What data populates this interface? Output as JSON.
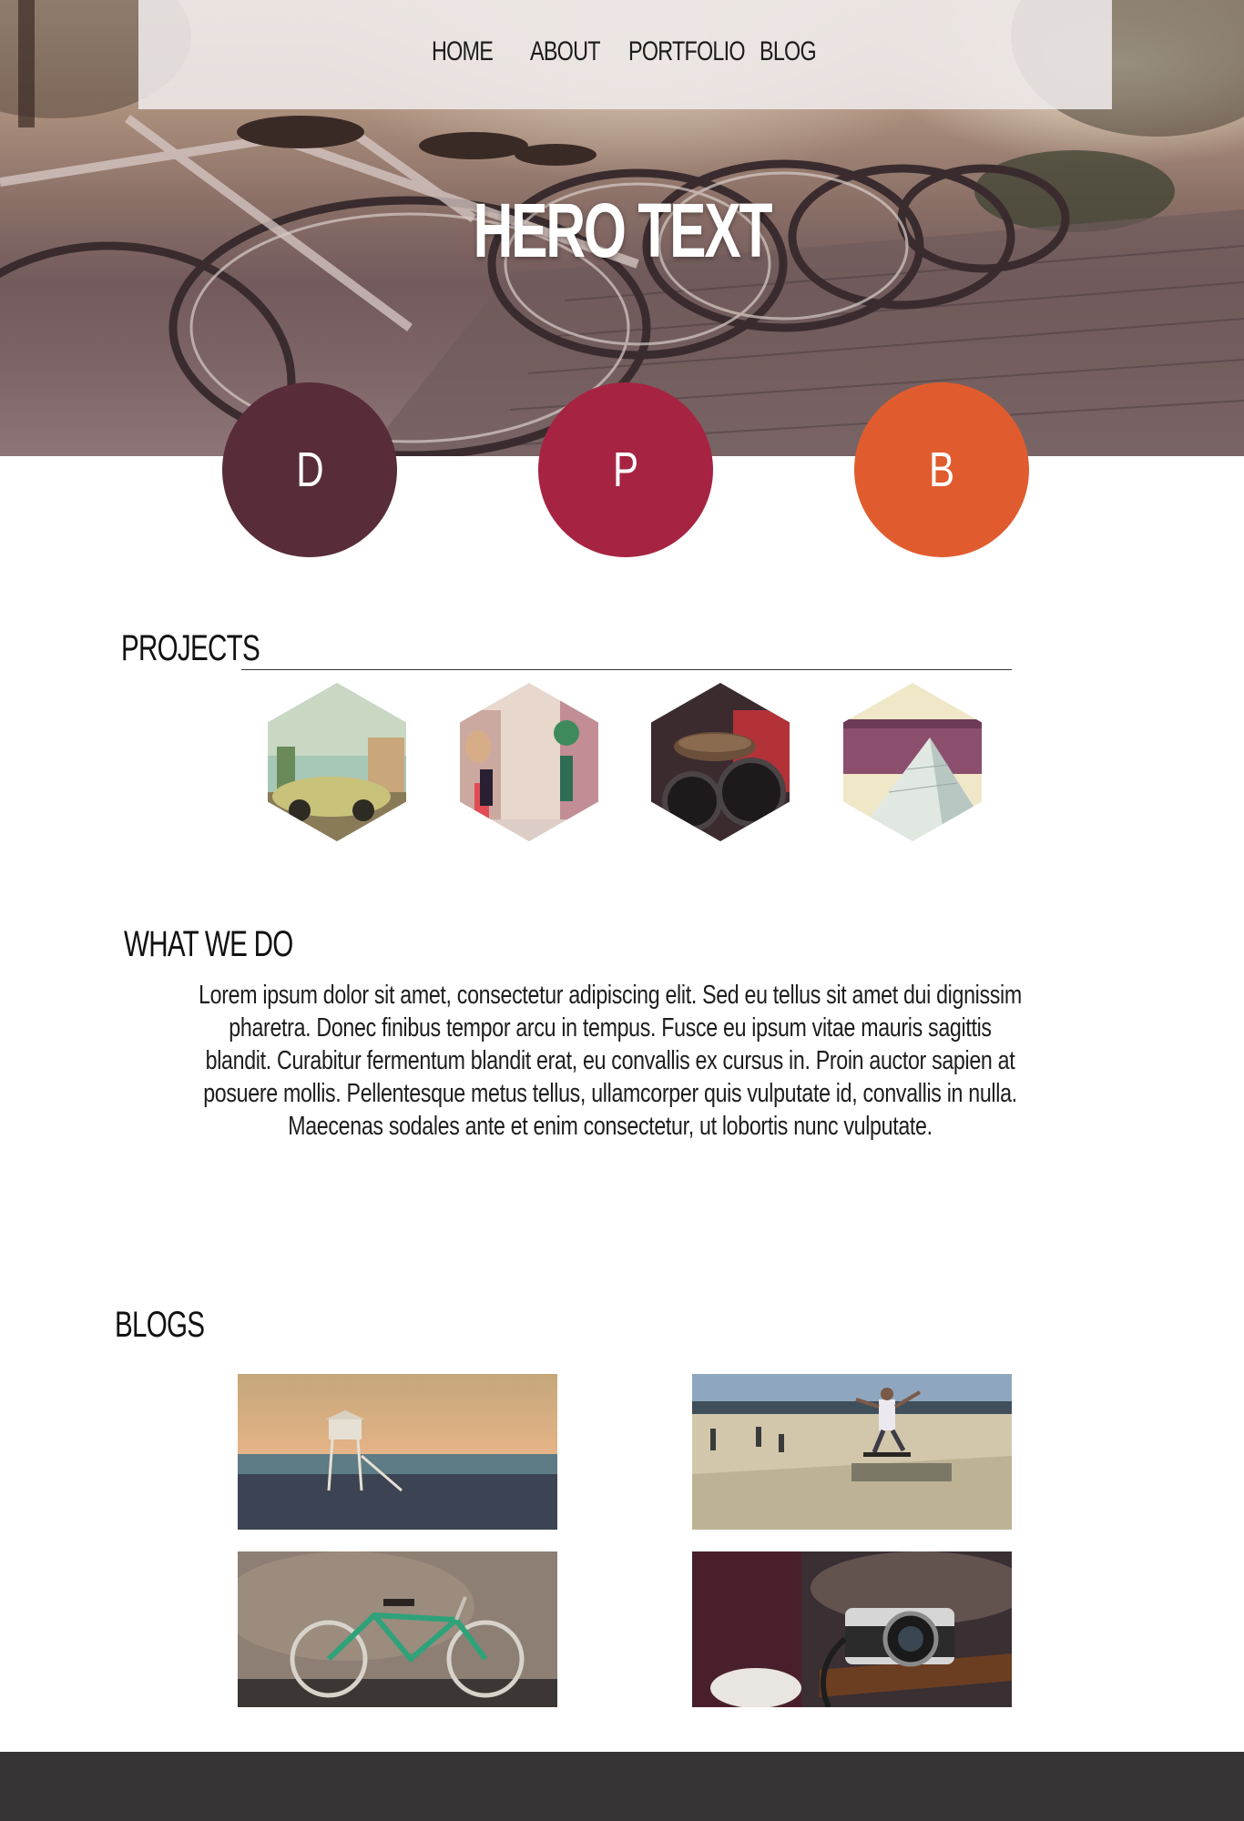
{
  "nav": {
    "items": [
      {
        "label": "HOME"
      },
      {
        "label": "ABOUT"
      },
      {
        "label": "PORTFOLIO"
      },
      {
        "label": "BLOG"
      }
    ]
  },
  "hero": {
    "title": "HERO TEXT",
    "image": "bicycles-in-a-row-photo"
  },
  "circles": [
    {
      "letter": "D",
      "color": "#582c39"
    },
    {
      "letter": "P",
      "color": "#a62442"
    },
    {
      "letter": "B",
      "color": "#e05c2e"
    }
  ],
  "projects": {
    "heading": "PROJECTS",
    "thumbnails": [
      "vintage-car-photo",
      "city-street-photo",
      "bicycle-saddle-photo",
      "louvre-pyramid-photo"
    ]
  },
  "what_we_do": {
    "heading": "WHAT WE DO",
    "body": "Lorem ipsum dolor sit amet, consectetur adipiscing elit. Sed eu tellus sit amet dui dignissim pharetra. Donec finibus tempor arcu in tempus. Fusce eu ipsum vitae mauris sagittis blandit. Curabitur fermentum blandit erat, eu convallis ex cursus in. Proin auctor sapien at posuere mollis. Pellentesque metus tellus, ullamcorper quis vulputate id, convallis in nulla. Maecenas sodales ante et enim consectetur, ut lobortis nunc vulputate."
  },
  "blogs": {
    "heading": "BLOGS",
    "images": [
      "lifeguard-tower-beach-photo",
      "skateboarder-photo",
      "green-bicycle-photo",
      "camera-on-table-photo"
    ]
  },
  "colors": {
    "footer": "#363434",
    "nav_background": "#eee9e9"
  }
}
